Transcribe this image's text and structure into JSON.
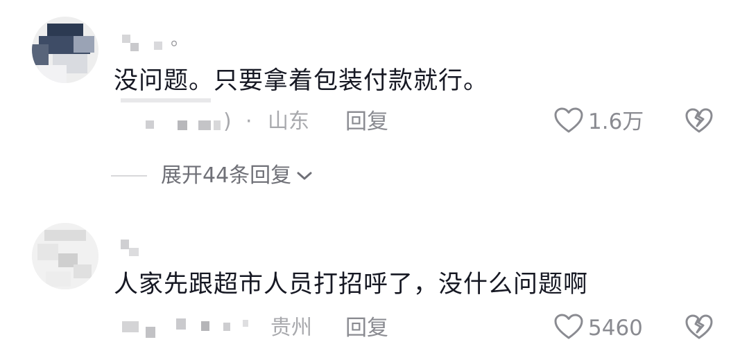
{
  "comments": [
    {
      "text": "没问题。只要拿着包装付款就行。",
      "location_prefix": "· ",
      "location": "山东",
      "reply_label": "回复",
      "like_count": "1.6万",
      "expand_replies_label": "展开44条回复",
      "username_suffix": "。"
    },
    {
      "text": "人家先跟超市人员打招呼了，没什么问题啊",
      "location": "贵州",
      "reply_label": "回复",
      "like_count": "5460"
    }
  ],
  "icons": {
    "like": "heart-outline-icon",
    "dislike": "broken-heart-icon",
    "expand": "chevron-down-icon"
  },
  "colors": {
    "text_primary": "#161823",
    "text_secondary": "#8a8b91",
    "text_location": "#a8a9ad"
  }
}
